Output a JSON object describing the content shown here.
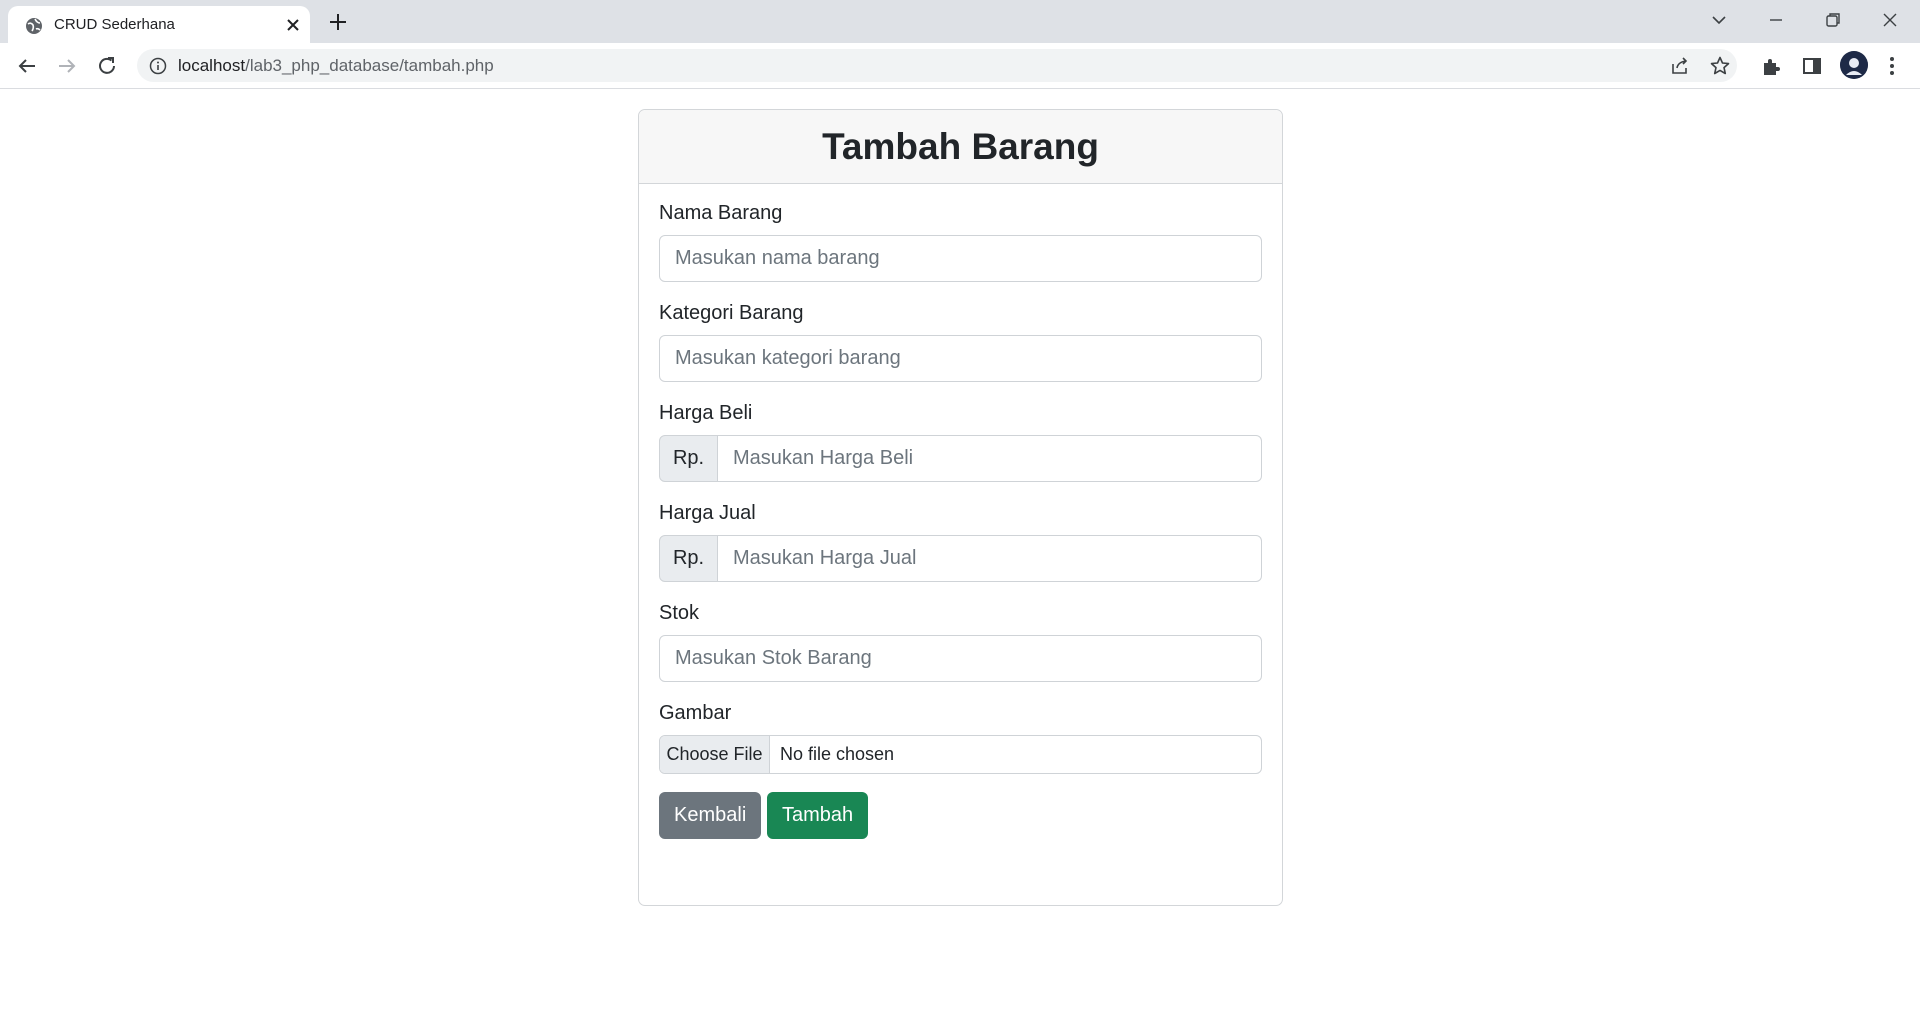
{
  "browser": {
    "tab_title": "CRUD Sederhana",
    "url_host": "localhost",
    "url_path": "/lab3_php_database/tambah.php"
  },
  "page": {
    "title": "Tambah Barang",
    "fields": {
      "nama": {
        "label": "Nama Barang",
        "placeholder": "Masukan nama barang",
        "value": ""
      },
      "kategori": {
        "label": "Kategori Barang",
        "placeholder": "Masukan kategori barang",
        "value": ""
      },
      "harga_beli": {
        "label": "Harga Beli",
        "prefix": "Rp.",
        "placeholder": "Masukan Harga Beli",
        "value": ""
      },
      "harga_jual": {
        "label": "Harga Jual",
        "prefix": "Rp.",
        "placeholder": "Masukan Harga Jual",
        "value": ""
      },
      "stok": {
        "label": "Stok",
        "placeholder": "Masukan Stok Barang",
        "value": ""
      },
      "gambar": {
        "label": "Gambar",
        "button": "Choose File",
        "status": "No file chosen"
      }
    },
    "buttons": {
      "back": "Kembali",
      "submit": "Tambah"
    }
  },
  "colors": {
    "secondary": "#6c757d",
    "success": "#198754",
    "tabstrip": "#dee1e6"
  },
  "icons": [
    "globe-icon",
    "close-icon",
    "plus-icon",
    "chevron-down-icon",
    "minimize-icon",
    "restore-icon",
    "window-close-icon",
    "back-arrow-icon",
    "forward-arrow-icon",
    "reload-icon",
    "info-icon",
    "share-icon",
    "star-icon",
    "puzzle-icon",
    "side-panel-icon",
    "avatar",
    "kebab-menu-icon"
  ]
}
